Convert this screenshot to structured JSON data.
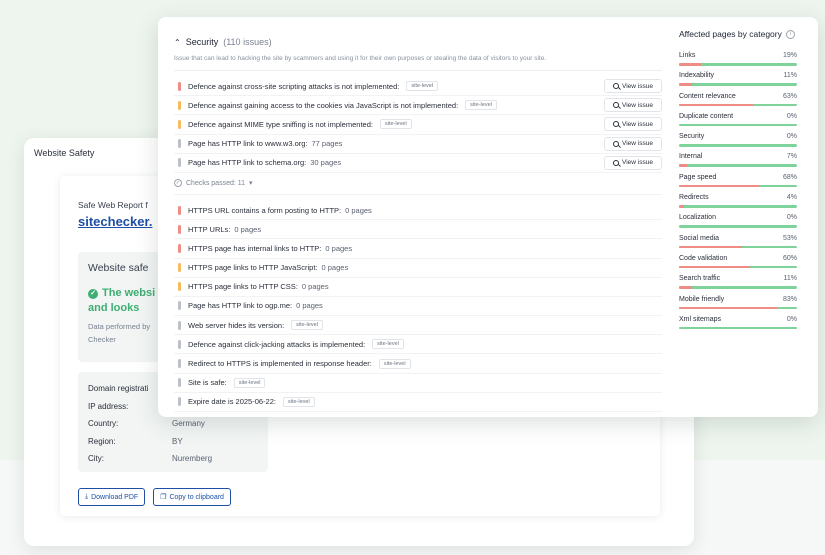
{
  "back": {
    "title": "Website Safety",
    "report_label": "Safe Web Report f",
    "site": "sitechecker.",
    "safe_title": "Website safe",
    "safe_msg_line1": "The websi",
    "safe_msg_line2": "and looks",
    "note_line1": "Data performed by",
    "note_line2": "Checker",
    "info": [
      {
        "k": "Domain registrati",
        "v": ""
      },
      {
        "k": "IP address:",
        "v": ""
      },
      {
        "k": "Country:",
        "v": "Germany"
      },
      {
        "k": "Region:",
        "v": "BY"
      },
      {
        "k": "City:",
        "v": "Nuremberg"
      }
    ],
    "download_label": "Download PDF",
    "copy_label": "Copy to clipboard"
  },
  "front": {
    "section_title": "Security",
    "section_count": "(110 issues)",
    "section_desc": "Issue that can lead to hacking the site by scammers and using it for their own purposes or stealing the data of visitors to your site.",
    "view_label": "View issue",
    "issues": [
      {
        "text": "Defence against cross-site scripting attacks is not implemented:",
        "tag": "site-level",
        "color": "red"
      },
      {
        "text": "Defence against gaining access to the cookies via JavaScript is not implemented:",
        "tag": "site-level",
        "color": "orange"
      },
      {
        "text": "Defence against MIME type sniffing is not implemented:",
        "tag": "site-level",
        "color": "orange"
      },
      {
        "text": "Page has HTTP link to www.w3.org:",
        "sub": "77 pages",
        "color": "gray"
      },
      {
        "text": "Page has HTTP link to schema.org:",
        "sub": "30 pages",
        "color": "gray"
      }
    ],
    "passed_label": "Checks passed: 11",
    "passed": [
      {
        "text": "HTTPS URL contains a form posting to HTTP:",
        "sub": "0 pages",
        "color": "red"
      },
      {
        "text": "HTTP URLs:",
        "sub": "0 pages",
        "color": "red"
      },
      {
        "text": "HTTPS page has internal links to HTTP:",
        "sub": "0 pages",
        "color": "red"
      },
      {
        "text": "HTTPS page links to HTTP JavaScript:",
        "sub": "0 pages",
        "color": "orange"
      },
      {
        "text": "HTTPS page links to HTTP CSS:",
        "sub": "0 pages",
        "color": "orange"
      },
      {
        "text": "Page has HTTP link to ogp.me:",
        "sub": "0 pages",
        "color": "gray"
      },
      {
        "text": "Web server hides its version:",
        "tag": "site-level",
        "color": "gray"
      },
      {
        "text": "Defence against click-jacking attacks is implemented:",
        "tag": "site-level",
        "color": "gray"
      },
      {
        "text": "Redirect to HTTPS is implemented in response header:",
        "tag": "site-level",
        "color": "gray"
      },
      {
        "text": "Site is safe:",
        "tag": "site-level",
        "color": "gray"
      },
      {
        "text": "Expire date is 2025-06-22:",
        "tag": "site-level",
        "color": "gray"
      }
    ],
    "categories_title": "Affected pages by category",
    "categories": [
      {
        "name": "Links",
        "pct": "19%",
        "value": 19
      },
      {
        "name": "Indexability",
        "pct": "11%",
        "value": 11
      },
      {
        "name": "Content relevance",
        "pct": "63%",
        "value": 63
      },
      {
        "name": "Duplicate content",
        "pct": "0%",
        "value": 0
      },
      {
        "name": "Security",
        "pct": "0%",
        "value": 0
      },
      {
        "name": "Internal",
        "pct": "7%",
        "value": 7
      },
      {
        "name": "Page speed",
        "pct": "68%",
        "value": 68
      },
      {
        "name": "Redirects",
        "pct": "4%",
        "value": 4
      },
      {
        "name": "Localization",
        "pct": "0%",
        "value": 0
      },
      {
        "name": "Social media",
        "pct": "53%",
        "value": 53
      },
      {
        "name": "Code validation",
        "pct": "60%",
        "value": 60
      },
      {
        "name": "Search traffic",
        "pct": "11%",
        "value": 11
      },
      {
        "name": "Mobile friendly",
        "pct": "83%",
        "value": 83
      },
      {
        "name": "Xml sitemaps",
        "pct": "0%",
        "value": 0
      }
    ]
  }
}
